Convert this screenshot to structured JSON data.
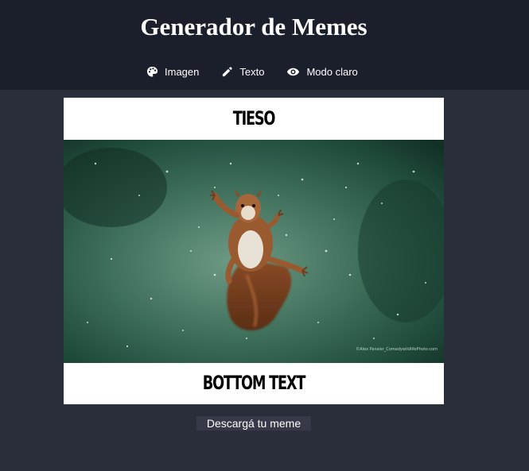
{
  "header": {
    "title": "Generador de Memes",
    "nav": [
      {
        "label": "Imagen",
        "icon": "palette-icon"
      },
      {
        "label": "Texto",
        "icon": "pencil-icon"
      },
      {
        "label": "Modo claro",
        "icon": "eye-icon"
      }
    ]
  },
  "meme": {
    "top_text": "TIESO",
    "bottom_text": "BOTTOM TEXT",
    "image_credit": "©Alex Pansier_ComedywildlifePhoto.com",
    "image_subject": "squirrel"
  },
  "download_label": "Descargá tu meme",
  "colors": {
    "header_bg": "#1b1f2c",
    "page_bg": "#2a2e3b",
    "button_bg": "#353948",
    "text": "#ffffff"
  }
}
